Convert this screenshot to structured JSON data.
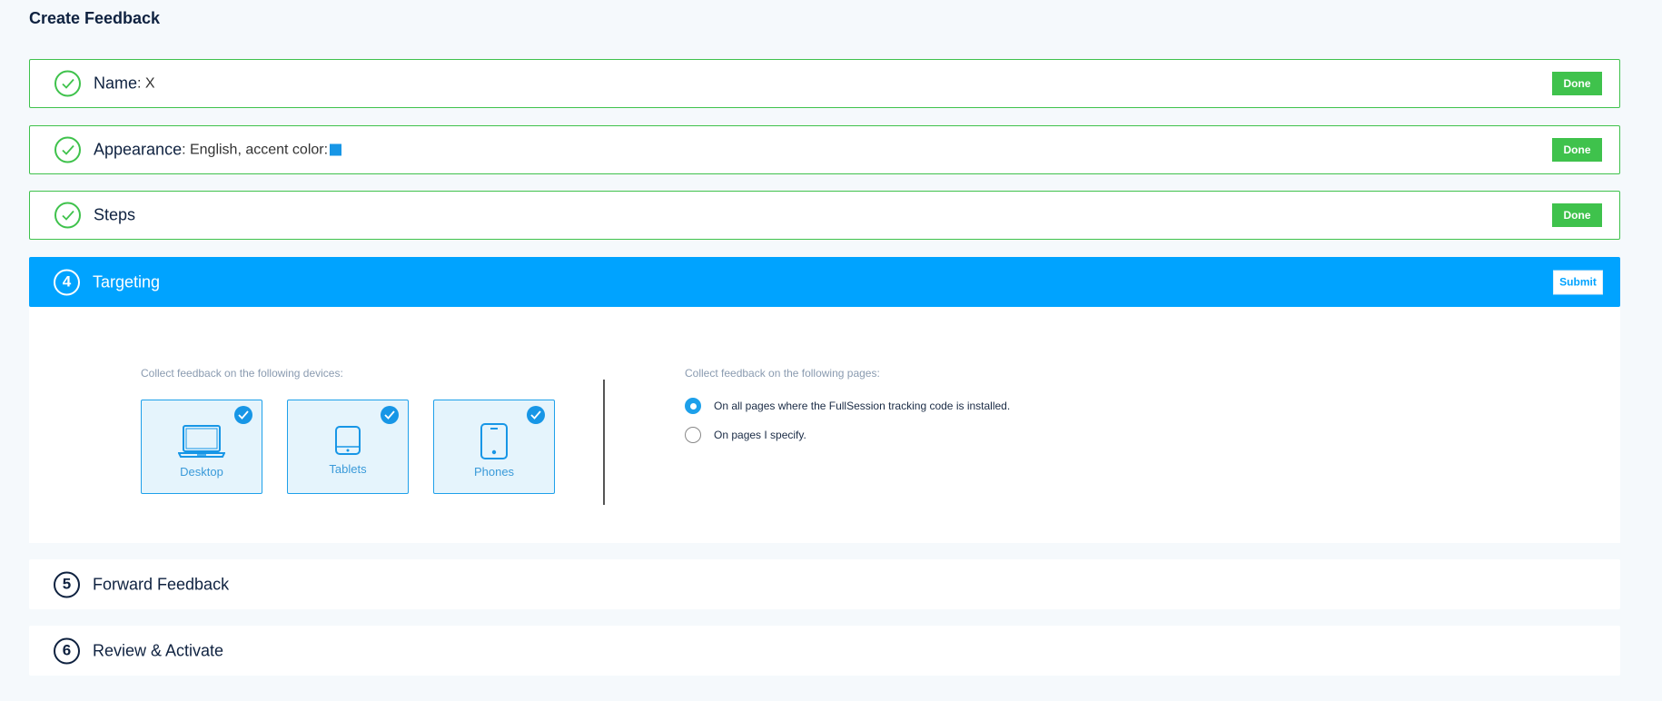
{
  "page": {
    "title": "Create Feedback"
  },
  "steps": [
    {
      "title": "Name",
      "detail": ": X",
      "status": "Done"
    },
    {
      "title": "Appearance",
      "detail": ": English, accent color:",
      "status": "Done",
      "accent_color": "#1796e6"
    },
    {
      "title": "Steps",
      "detail": "",
      "status": "Done"
    },
    {
      "number": "4",
      "title": "Targeting",
      "action": "Submit"
    },
    {
      "number": "5",
      "title": "Forward Feedback"
    },
    {
      "number": "6",
      "title": "Review & Activate"
    }
  ],
  "targeting": {
    "devices_label": "Collect feedback on the following devices:",
    "devices": [
      {
        "label": "Desktop",
        "icon": "laptop-icon",
        "checked": true
      },
      {
        "label": "Tablets",
        "icon": "tablet-icon",
        "checked": true
      },
      {
        "label": "Phones",
        "icon": "phone-icon",
        "checked": true
      }
    ],
    "pages_label": "Collect feedback on the following pages:",
    "page_options": [
      {
        "label": "On all pages where the FullSession tracking code is installed.",
        "selected": true
      },
      {
        "label": "On pages I specify.",
        "selected": false
      }
    ]
  },
  "colors": {
    "done_green": "#3fc24c",
    "active_blue": "#00a3ff",
    "accent": "#1796e6"
  }
}
